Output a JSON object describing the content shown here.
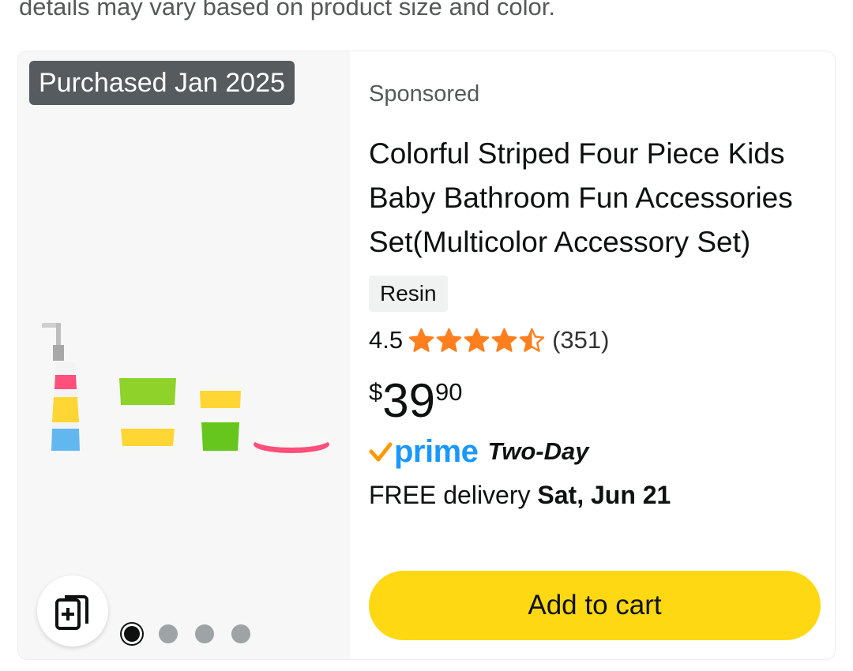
{
  "top_text": "details may vary based on product size and color.",
  "product": {
    "badge": "Purchased Jan 2025",
    "sponsored": "Sponsored",
    "title": "Colorful Striped Four Piece Kids Baby Bathroom Fun Accessories Set(Multicolor Accessory Set)",
    "variant": "Resin",
    "rating": "4.5",
    "rating_value": 4.5,
    "review_count": "(351)",
    "price": {
      "symbol": "$",
      "whole": "39",
      "fraction": "90"
    },
    "prime": {
      "word": "prime",
      "speed": "Two-Day"
    },
    "delivery": {
      "prefix": "FREE delivery",
      "date": "Sat, Jun 21"
    },
    "add_to_cart": "Add to cart",
    "image_pages": 4,
    "current_page": 1
  },
  "icons": {
    "compare": "compare-cards-icon",
    "star": "star-icon",
    "prime_check": "prime-check-icon"
  },
  "colors": {
    "cart_button": "#ffd814",
    "star": "#ff7f1f",
    "prime": "#1a98ff",
    "prime_check": "#ff9900",
    "badge": "#555b5e"
  }
}
